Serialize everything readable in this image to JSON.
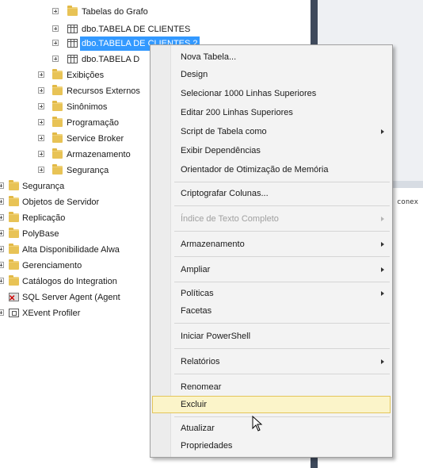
{
  "tree": {
    "items": [
      {
        "label": "Tabelas do Grafo",
        "icon": "folder-icon"
      },
      {
        "label": "dbo.TABELA DE CLIENTES",
        "icon": "table-icon"
      },
      {
        "label": "dbo.TABELA DE CLIENTES 2",
        "icon": "table-icon"
      },
      {
        "label": "dbo.TABELA D",
        "icon": "table-icon"
      },
      {
        "label": "Exibições",
        "icon": "folder-icon"
      },
      {
        "label": "Recursos Externos",
        "icon": "folder-icon"
      },
      {
        "label": "Sinônimos",
        "icon": "folder-icon"
      },
      {
        "label": "Programação",
        "icon": "folder-icon"
      },
      {
        "label": "Service Broker",
        "icon": "folder-icon"
      },
      {
        "label": "Armazenamento",
        "icon": "folder-icon"
      },
      {
        "label": "Segurança",
        "icon": "folder-icon"
      },
      {
        "label": "Segurança",
        "icon": "folder-icon"
      },
      {
        "label": "Objetos de Servidor",
        "icon": "folder-icon"
      },
      {
        "label": "Replicação",
        "icon": "folder-icon"
      },
      {
        "label": "PolyBase",
        "icon": "folder-icon"
      },
      {
        "label": "Alta Disponibilidade Alwa",
        "icon": "folder-icon"
      },
      {
        "label": "Gerenciamento",
        "icon": "folder-icon"
      },
      {
        "label": "Catálogos do Integration",
        "icon": "folder-icon"
      },
      {
        "label": "SQL Server Agent (Agent",
        "icon": "agent-icon"
      },
      {
        "label": "XEvent Profiler",
        "icon": "xevent-icon"
      }
    ]
  },
  "right_pane": {
    "partial_text": "conex"
  },
  "context_menu": {
    "items": [
      {
        "label": "Nova Tabela..."
      },
      {
        "label": "Design"
      },
      {
        "label": "Selecionar 1000 Linhas Superiores"
      },
      {
        "label": "Editar 200 Linhas Superiores"
      },
      {
        "label": "Script de Tabela como"
      },
      {
        "label": "Exibir Dependências"
      },
      {
        "label": "Orientador de Otimização de Memória"
      },
      {
        "label": "Criptografar Colunas..."
      },
      {
        "label": "Índice de Texto Completo"
      },
      {
        "label": "Armazenamento"
      },
      {
        "label": "Ampliar"
      },
      {
        "label": "Políticas"
      },
      {
        "label": "Facetas"
      },
      {
        "label": "Iniciar PowerShell"
      },
      {
        "label": "Relatórios"
      },
      {
        "label": "Renomear"
      },
      {
        "label": "Excluir"
      },
      {
        "label": "Atualizar"
      },
      {
        "label": "Propriedades"
      }
    ]
  },
  "colors": {
    "selection": "#3399ff",
    "hover": "#fbf4c9",
    "divider": "#3f4a5c"
  }
}
